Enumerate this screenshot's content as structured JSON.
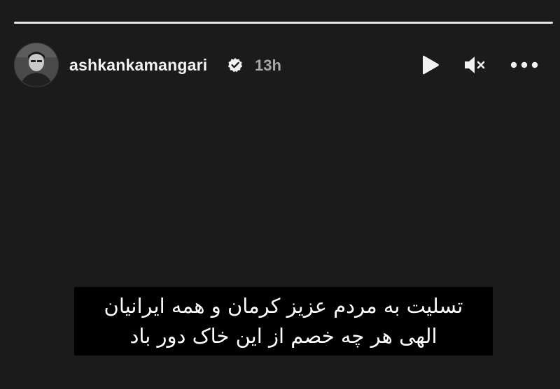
{
  "story": {
    "progress": 1.0
  },
  "header": {
    "username": "ashkankamangari",
    "verified_icon": "verified-badge-icon",
    "time_ago": "13h",
    "controls": {
      "play_icon": "play-icon",
      "mute_icon": "mute-icon",
      "more_icon": "more-options-icon"
    }
  },
  "caption": {
    "lines": [
      "تسلیت به مردم عزیز کرمان و همه ایرانیان",
      "الهی هر چه خصم از این خاک دور باد"
    ]
  },
  "colors": {
    "background": "#1b1b1b",
    "text": "#f2f2f2",
    "muted_text": "#a8a8a8",
    "caption_bg": "#000000"
  }
}
